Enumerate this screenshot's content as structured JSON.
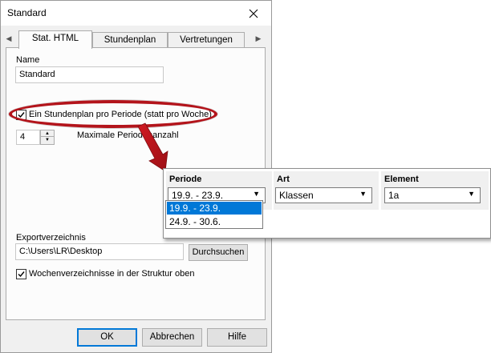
{
  "window": {
    "title": "Standard"
  },
  "tabs": [
    {
      "label": "Stat. HTML",
      "active": true
    },
    {
      "label": "Stundenplan",
      "active": false
    },
    {
      "label": "Vertretungen",
      "active": false
    }
  ],
  "form": {
    "name_label": "Name",
    "name_value": "Standard",
    "per_period_label": "Ein Stundenplan pro Periode (statt pro Woche)",
    "per_period_checked": true,
    "max_periods_value": "4",
    "max_periods_label": "Maximale Periodenanzahl",
    "export_dir_label": "Exportverzeichnis",
    "export_dir_value": "C:\\Users\\LR\\Desktop",
    "browse_label": "Durchsuchen",
    "week_dirs_label": "Wochenverzeichnisse in der Struktur oben",
    "week_dirs_checked": true
  },
  "buttons": {
    "ok": "OK",
    "cancel": "Abbrechen",
    "help": "Hilfe"
  },
  "callout": {
    "period_header": "Periode",
    "period_value": "19.9. - 23.9.",
    "period_options": [
      "19.9. - 23.9.",
      "24.9. - 30.6."
    ],
    "type_header": "Art",
    "type_value": "Klassen",
    "element_header": "Element",
    "element_value": "1a"
  },
  "colors": {
    "highlight": "#b3141b",
    "selection": "#0078d7"
  }
}
